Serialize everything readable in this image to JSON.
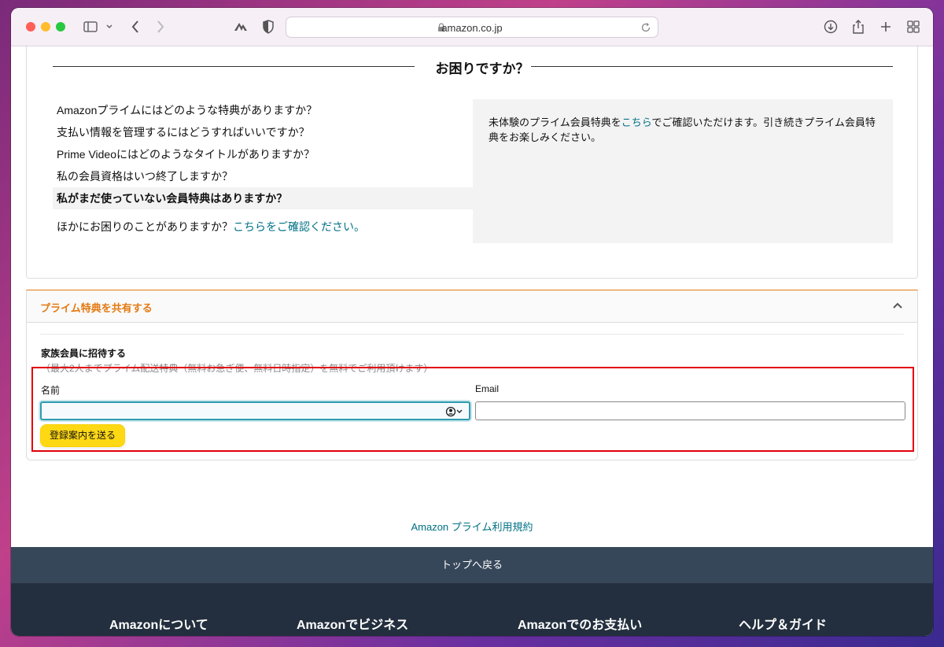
{
  "browser": {
    "url": "amazon.co.jp"
  },
  "help": {
    "title": "お困りですか？",
    "faq": [
      "Amazonプライムにはどのような特典がありますか？",
      "支払い情報を管理するにはどうすればいいですか？",
      "Prime Videoにはどのようなタイトルがありますか？",
      "私の会員資格はいつ終了しますか？",
      "私がまだ使っていない会員特典はありますか？"
    ],
    "active_index": 4,
    "more_text": "ほかにお困りのことがありますか？",
    "more_link": "こちらをご確認ください。",
    "answer_pre": "未体験のプライム会員特典を",
    "answer_link": "こちら",
    "answer_post": "でご確認いただけます。引き続きプライム会員特典をお楽しみください。"
  },
  "share": {
    "header": "プライム特典を共有する",
    "invite_title": "家族会員に招待する",
    "invite_sub": "（最大2人までプライム配送特典（無料お急ぎ便、無料日時指定）を無料でご利用頂けます）",
    "name_label": "名前",
    "email_label": "Email",
    "name_value": "",
    "email_value": "",
    "submit_label": "登録案内を送る"
  },
  "terms_link": "Amazon プライム利用規約",
  "back_to_top": "トップへ戻る",
  "footer_columns": [
    "Amazonについて",
    "Amazonでビジネス",
    "Amazonでのお支払い",
    "ヘルプ＆ガイド"
  ],
  "colors": {
    "accent_orange": "#e47911",
    "link_teal": "#007185",
    "button_yellow": "#ffd814",
    "highlight_red": "#e3000b",
    "footer_dark": "#232f3e",
    "back_top_bg": "#37475a"
  },
  "icons": [
    "sidebar-icon",
    "chevron-down-icon",
    "back-icon",
    "forward-icon",
    "extension-icon",
    "privacy-shield-icon",
    "lock-icon",
    "reload-icon",
    "download-icon",
    "share-icon",
    "new-tab-icon",
    "tab-overview-icon",
    "chevron-up-icon",
    "contact-autofill-icon"
  ]
}
